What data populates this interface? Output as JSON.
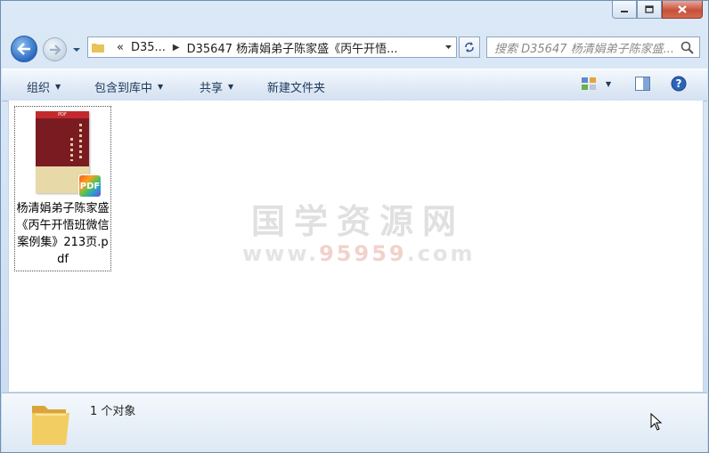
{
  "window": {
    "caption_buttons": [
      "minimize",
      "maximize",
      "close"
    ]
  },
  "nav": {
    "address_segments": [
      "«",
      "D35...",
      "D35647 杨清娟弟子陈家盛《丙午开悟..."
    ],
    "search_placeholder": "搜索 D35647 杨清娟弟子陈家盛..."
  },
  "toolbar": {
    "organize": "组织",
    "include_library": "包含到库中",
    "share": "共享",
    "new_folder": "新建文件夹"
  },
  "files": [
    {
      "name": "杨清娟弟子陈家盛《丙午开悟班微信案例集》213页.pdf",
      "thumb_header": "PDF",
      "badge": "PDF"
    }
  ],
  "watermark": {
    "line1": "国学资源网",
    "line2_prefix": "www.",
    "line2_highlight": "95959",
    "line2_suffix": ".com"
  },
  "status": {
    "count": "1 个对象"
  },
  "colors": {
    "accent": "#1e395b",
    "close": "#c7503a",
    "pdf_cover": "#7a1b22"
  }
}
